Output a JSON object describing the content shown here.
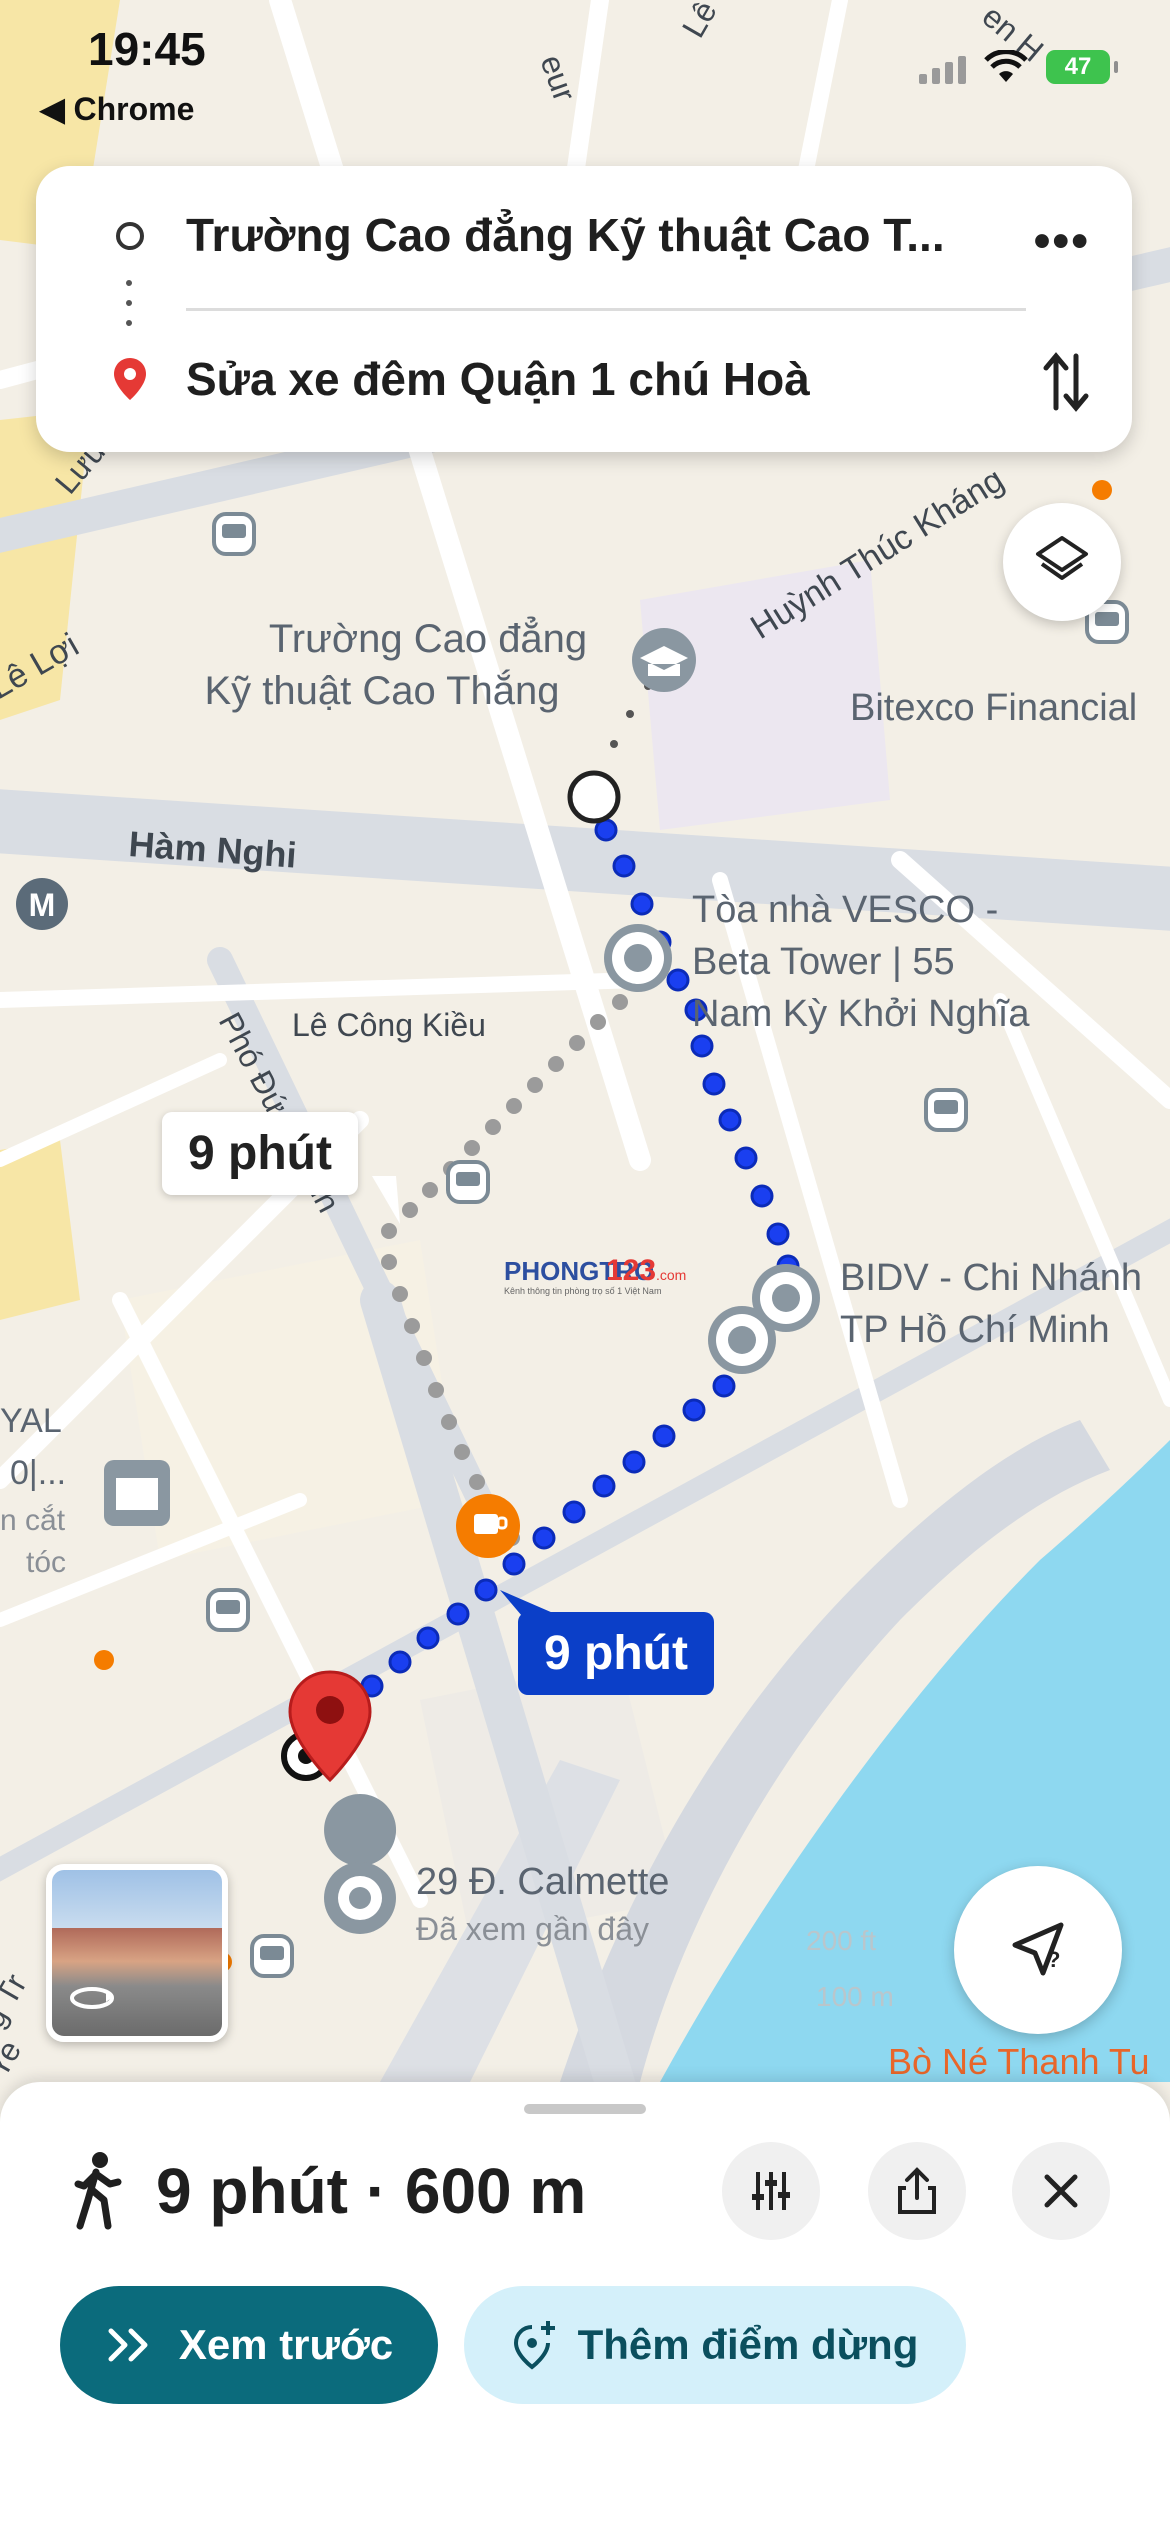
{
  "status_bar": {
    "time": "19:45",
    "back_app": "◀ Chrome",
    "battery": "47"
  },
  "route": {
    "origin": "Trường Cao đẳng Kỹ thuật Cao T...",
    "destination": "Sửa xe đêm Quận 1 chú Hoà"
  },
  "map": {
    "labels": {
      "cao_thang": [
        "Trường Cao đẳng",
        "Kỹ thuật Cao Thắng"
      ],
      "bitexco": "Bitexco Financial",
      "vesco": [
        "Tòa nhà VESCO -",
        "Beta Tower | 55",
        "Nam Kỳ Khởi Nghĩa"
      ],
      "bidv": [
        "BIDV - Chi Nhánh",
        "TP Hồ Chí Minh"
      ],
      "calmette": "29 Đ. Calmette",
      "calmette_sub": "Đã xem gần đây",
      "bo_ne": "Bò Né Thanh Tu",
      "yal_shop": [
        "YAL",
        "0|...",
        "n cắt",
        "tóc"
      ],
      "scale": [
        "200 ft",
        "100 m"
      ]
    },
    "streets": {
      "ham_nghi": "Hàm Nghi",
      "le_cong_kieu": "Lê Công Kiều",
      "huynh_thuc_khang": "Huỳnh Thúc Kháng",
      "le_loi": "Lê Lợi",
      "pho_duc_chinh": "Phó Đức Chính",
      "top_street_1": "eur",
      "top_street_2": "Lê D",
      "top_street_3": "en H",
      "luu": "Lưu",
      "bottom_left_1": "g Tr",
      "bottom_left_2": "Ye"
    },
    "time_label_alt": "9 phút",
    "time_label_main": "9 phút",
    "watermark_brand": "PHONGTRO",
    "watermark_num": "123",
    "watermark_domain": ".com",
    "watermark_tag": "Kênh thông tin phòng trọ số 1 Việt Nam",
    "metro_badge": "M"
  },
  "sheet": {
    "summary": "9 phút · 600 m",
    "preview_label": "Xem trước",
    "add_stop_label": "Thêm điểm dừng"
  },
  "colors": {
    "route_blue": "#1a3ff0",
    "route_alt_gray": "#9b9b9b",
    "water": "#8ed8f0",
    "preview_button": "#0b6b7c",
    "pin_red": "#e53935"
  }
}
